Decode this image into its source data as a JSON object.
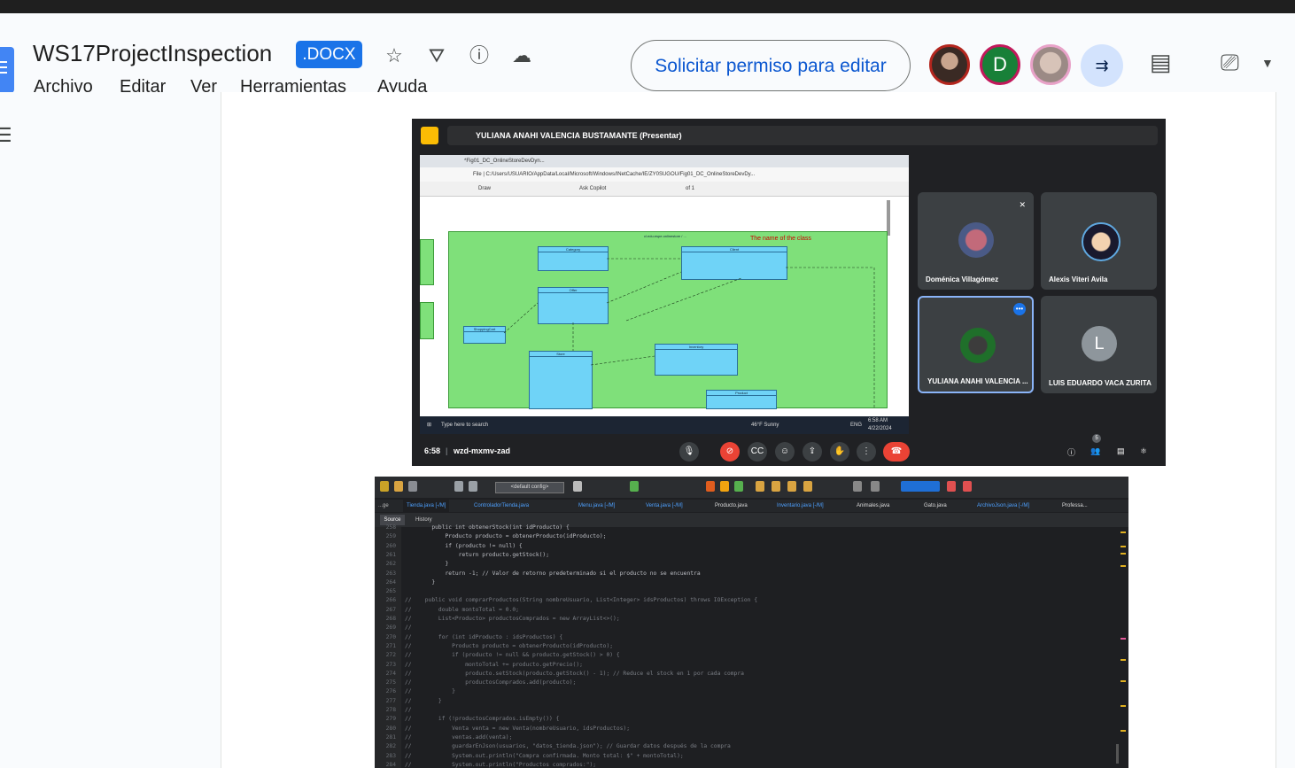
{
  "header": {
    "title": "WS17ProjectInspection",
    "badge": ".DOCX",
    "menu": [
      "Archivo",
      "Editar",
      "Ver",
      "Herramientas",
      "Ayuda"
    ],
    "permission_button": "Solicitar permiso para editar",
    "avatar_d_letter": "D"
  },
  "meet": {
    "presenter_bar": "YULIANA ANAHI VALENCIA BUSTAMANTE (Presentar)",
    "browser_tab": "*Fig01_DC_OnlineStoreDevDyn...",
    "address": "File | C:/Users/USUARIO/AppData/Local/Microsoft/Windows/INetCache/IE/ZY0SUGOU/Fig01_DC_OnlineStoreDevDy...",
    "pdf_draw": "Draw",
    "pdf_ask": "Ask Copilot",
    "pdf_page": "of 1",
    "diagram_label": "The name of the class",
    "diagram_top_label": "cl.edu.espe.onlinestore / ...",
    "uml_classes": [
      "Category",
      "Offer",
      "Client",
      "Inventory",
      "Store",
      "Product",
      "ShoppingCart"
    ],
    "taskbar_search": "Type here to search",
    "taskbar_weather": "46°F Sunny",
    "taskbar_lang": "ENG",
    "taskbar_time": "6:58 AM",
    "taskbar_date": "4/22/2024",
    "participants": [
      {
        "name": "Doménica Villagómez"
      },
      {
        "name": "Alexis Viteri Avila"
      },
      {
        "name": "YULIANA ANAHI VALENCIA ..."
      },
      {
        "name": "LUIS EDUARDO VACA ZURITA",
        "initial": "L"
      }
    ],
    "time": "6:58",
    "meeting_code": "wzd-mxmv-zad",
    "people_count": "5"
  },
  "ide": {
    "config": "<default config>",
    "tabs": [
      "...ge",
      "Tienda.java [-/M]",
      "ControladorTienda.java",
      "Menu.java [-/M]",
      "Venta.java [-/M]",
      "Producto.java",
      "Inventario.java [-/M]",
      "Animales.java",
      "Gato.java",
      "ArchivoJson.java [-/M]",
      "Professa..."
    ],
    "source_tab": "Source",
    "history_tab": "History",
    "lines": [
      {
        "n": "258",
        "code": "        public int obtenerStock(int idProducto) {"
      },
      {
        "n": "259",
        "code": "            Producto producto = obtenerProducto(idProducto);"
      },
      {
        "n": "260",
        "code": "            if (producto != null) {"
      },
      {
        "n": "261",
        "code": "                return producto.getStock();"
      },
      {
        "n": "262",
        "code": "            }"
      },
      {
        "n": "263",
        "code": "            return -1; // Valor de retorno predeterminado si el producto no se encuentra"
      },
      {
        "n": "264",
        "code": "        }"
      },
      {
        "n": "265",
        "code": ""
      },
      {
        "n": "266",
        "code": "//    public void comprarProductos(String nombreUsuario, List<Integer> idsProductos) throws IOException {"
      },
      {
        "n": "267",
        "code": "//        double montoTotal = 0.0;"
      },
      {
        "n": "268",
        "code": "//        List<Producto> productosComprados = new ArrayList<>();"
      },
      {
        "n": "269",
        "code": "//"
      },
      {
        "n": "270",
        "code": "//        for (int idProducto : idsProductos) {"
      },
      {
        "n": "271",
        "code": "//            Producto producto = obtenerProducto(idProducto);"
      },
      {
        "n": "272",
        "code": "//            if (producto != null && producto.getStock() > 0) {"
      },
      {
        "n": "273",
        "code": "//                montoTotal += producto.getPrecio();"
      },
      {
        "n": "274",
        "code": "//                producto.setStock(producto.getStock() - 1); // Reduce el stock en 1 por cada compra"
      },
      {
        "n": "275",
        "code": "//                productosComprados.add(producto);"
      },
      {
        "n": "276",
        "code": "//            }"
      },
      {
        "n": "277",
        "code": "//        }"
      },
      {
        "n": "278",
        "code": "//"
      },
      {
        "n": "279",
        "code": "//        if (!productosComprados.isEmpty()) {"
      },
      {
        "n": "280",
        "code": "//            Venta venta = new Venta(nombreUsuario, idsProductos);"
      },
      {
        "n": "281",
        "code": "//            ventas.add(venta);"
      },
      {
        "n": "282",
        "code": "//            guardarEnJson(usuarios, \"datos_tienda.json\"); // Guardar datos después de la compra"
      },
      {
        "n": "283",
        "code": "//            System.out.println(\"Compra confirmada. Monto total: $\" + montoTotal);"
      },
      {
        "n": "284",
        "code": "//            System.out.println(\"Productos comprados:\");"
      }
    ]
  }
}
